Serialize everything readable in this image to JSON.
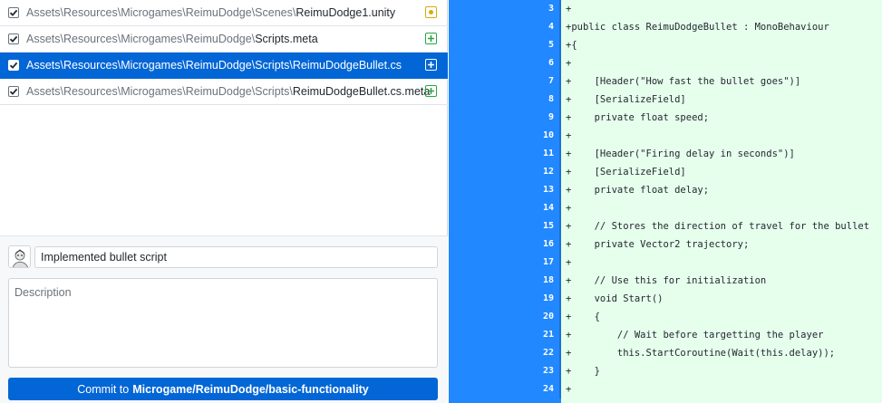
{
  "files": [
    {
      "dir": "Assets\\Resources\\Microgames\\ReimuDodge\\Scenes\\",
      "name": "ReimuDodge1.unity",
      "status": "modified",
      "selected": false
    },
    {
      "dir": "Assets\\Resources\\Microgames\\ReimuDodge\\",
      "name": "Scripts.meta",
      "status": "added",
      "selected": false
    },
    {
      "dir": "Assets\\Resources\\Microgames\\ReimuDodge\\Scripts\\",
      "name": "ReimuDodgeBullet.cs",
      "status": "added",
      "selected": true
    },
    {
      "dir": "Assets\\Resources\\Microgames\\ReimuDodge\\Scripts\\",
      "name": "ReimuDodgeBullet.cs.meta",
      "status": "added",
      "selected": false
    }
  ],
  "commit": {
    "summary": "Implemented bullet script",
    "description_placeholder": "Description",
    "button_prefix": "Commit to",
    "branch": "Microgame/ReimuDodge/basic-functionality"
  },
  "diff": {
    "lines": [
      {
        "n": "3",
        "text": "+"
      },
      {
        "n": "4",
        "text": "+public class ReimuDodgeBullet : MonoBehaviour"
      },
      {
        "n": "5",
        "text": "+{"
      },
      {
        "n": "6",
        "text": "+"
      },
      {
        "n": "7",
        "text": "+    [Header(\"How fast the bullet goes\")]"
      },
      {
        "n": "8",
        "text": "+    [SerializeField]"
      },
      {
        "n": "9",
        "text": "+    private float speed;"
      },
      {
        "n": "10",
        "text": "+"
      },
      {
        "n": "11",
        "text": "+    [Header(\"Firing delay in seconds\")]"
      },
      {
        "n": "12",
        "text": "+    [SerializeField]"
      },
      {
        "n": "13",
        "text": "+    private float delay;"
      },
      {
        "n": "14",
        "text": "+"
      },
      {
        "n": "15",
        "text": "+    // Stores the direction of travel for the bullet"
      },
      {
        "n": "16",
        "text": "+    private Vector2 trajectory;"
      },
      {
        "n": "17",
        "text": "+"
      },
      {
        "n": "18",
        "text": "+    // Use this for initialization"
      },
      {
        "n": "19",
        "text": "+    void Start()"
      },
      {
        "n": "20",
        "text": "+    {"
      },
      {
        "n": "21",
        "text": "+        // Wait before targetting the player"
      },
      {
        "n": "22",
        "text": "+        this.StartCoroutine(Wait(this.delay));"
      },
      {
        "n": "23",
        "text": "+    }"
      },
      {
        "n": "24",
        "text": "+"
      }
    ]
  },
  "colors": {
    "accent": "#0366d6",
    "gutter": "#2188ff",
    "added_bg": "#e6ffed",
    "modified": "#dbab09",
    "added": "#28a745"
  }
}
